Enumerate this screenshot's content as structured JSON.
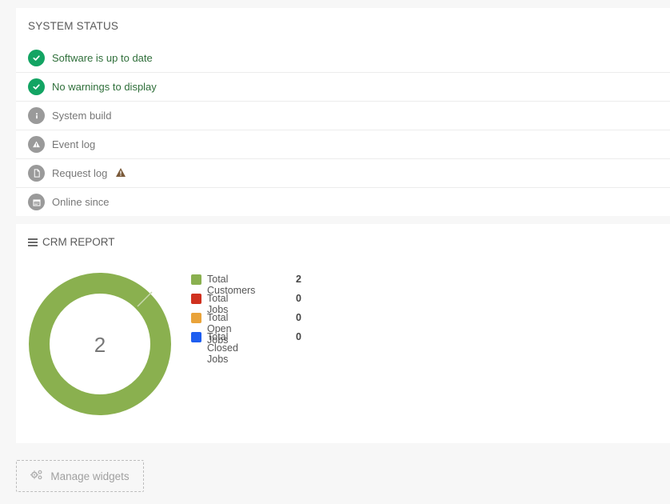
{
  "system_status": {
    "title": "SYSTEM STATUS",
    "items": [
      {
        "label": "Software is up to date",
        "icon": "check-icon",
        "state": "ok"
      },
      {
        "label": "No warnings to display",
        "icon": "check-icon",
        "state": "ok"
      },
      {
        "label": "System build",
        "icon": "info-icon",
        "state": "muted"
      },
      {
        "label": "Event log",
        "icon": "warning-icon",
        "state": "muted"
      },
      {
        "label": "Request log",
        "icon": "file-icon",
        "state": "muted",
        "badge": "warning-triangle-icon"
      },
      {
        "label": "Online since",
        "icon": "calendar-icon",
        "state": "muted"
      }
    ]
  },
  "crm_report": {
    "title": "CRM REPORT",
    "center_value": "2",
    "legend": [
      {
        "label": "Total Customers",
        "value": "2",
        "color": "#8ab04f"
      },
      {
        "label": "Total Jobs",
        "value": "0",
        "color": "#d0311f"
      },
      {
        "label": "Total Open Jobs",
        "value": "0",
        "color": "#e9a33a"
      },
      {
        "label": "Total Closed Jobs",
        "value": "0",
        "color": "#1e5ef0"
      }
    ]
  },
  "footer": {
    "manage_widgets_label": "Manage widgets"
  },
  "colors": {
    "ok_green": "#13a463",
    "muted_gray": "#9a9a9a",
    "warn_brown": "#7a5a3a"
  }
}
